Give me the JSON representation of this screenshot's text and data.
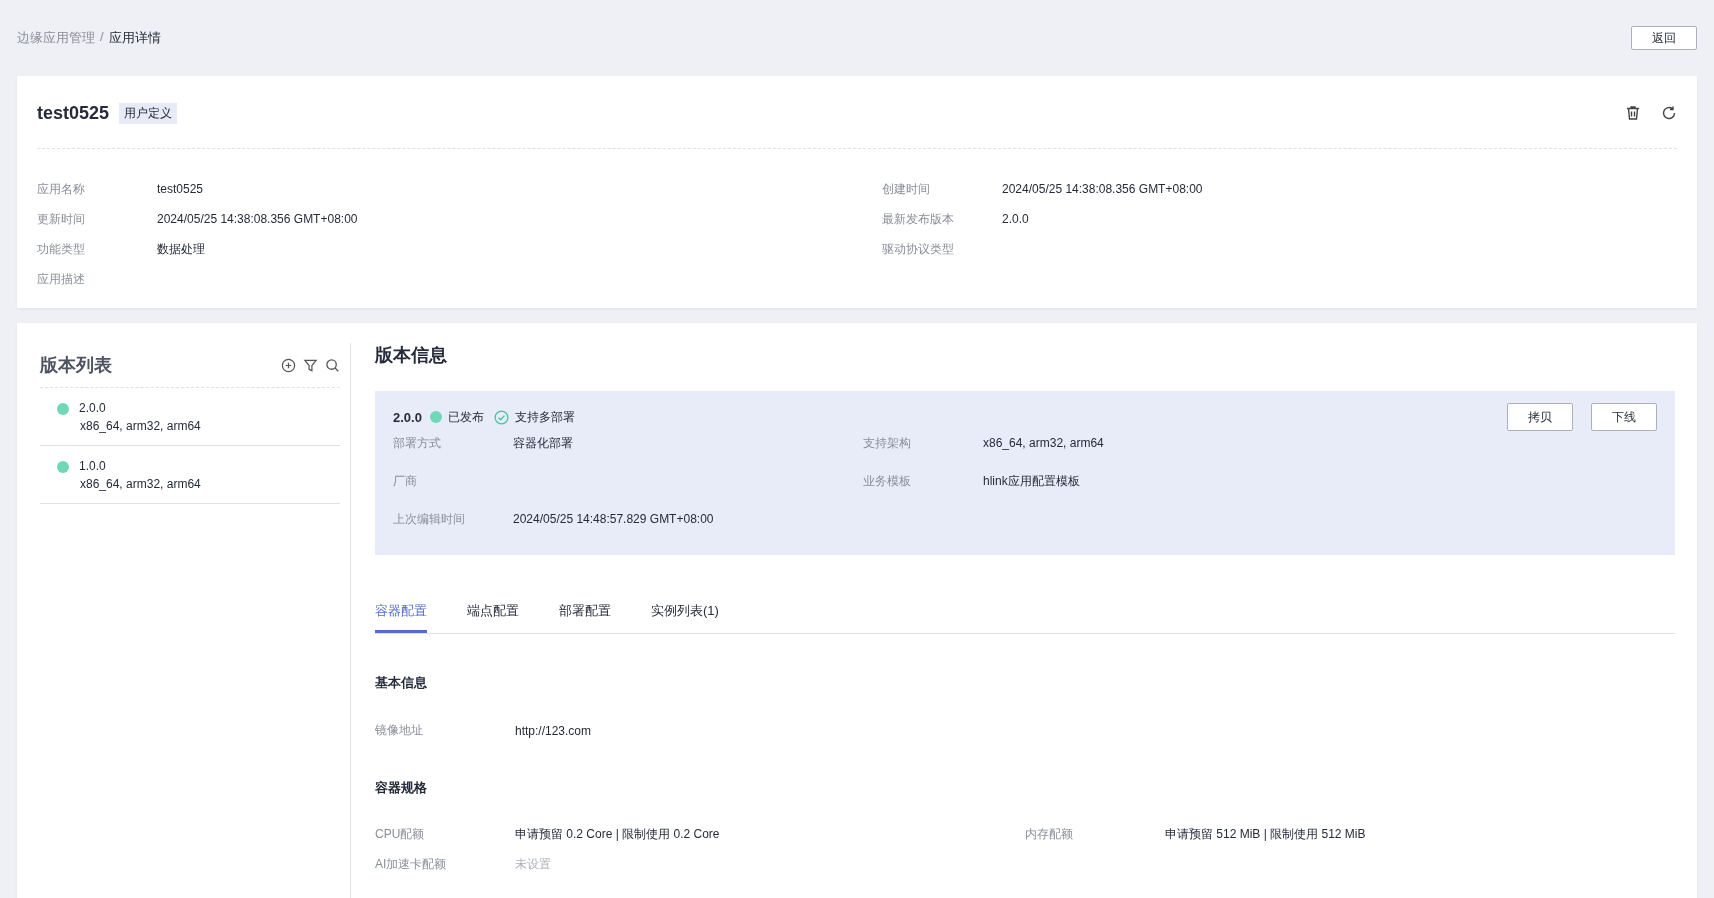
{
  "breadcrumb": {
    "parent": "边缘应用管理",
    "separator": "/",
    "current": "应用详情"
  },
  "back_button": "返回",
  "app": {
    "name": "test0525",
    "tag": "用户定义",
    "fields_left": [
      {
        "label": "应用名称",
        "value": "test0525"
      },
      {
        "label": "更新时间",
        "value": "2024/05/25 14:38:08.356 GMT+08:00"
      },
      {
        "label": "功能类型",
        "value": "数据处理"
      },
      {
        "label": "应用描述"
      }
    ],
    "fields_right": [
      {
        "label": "创建时间",
        "value": "2024/05/25 14:38:08.356 GMT+08:00"
      },
      {
        "label": "最新发布版本",
        "value": "2.0.0"
      },
      {
        "label": "驱动协议类型"
      }
    ]
  },
  "version_list": {
    "title": "版本列表",
    "items": [
      {
        "version": "2.0.0",
        "arch": "x86_64, arm32, arm64"
      },
      {
        "version": "1.0.0",
        "arch": "x86_64, arm32, arm64"
      }
    ]
  },
  "version_info": {
    "title": "版本信息",
    "version": "2.0.0",
    "status": "已发布",
    "multi_deploy": "支持多部署",
    "buttons": [
      "拷贝",
      "下线"
    ],
    "fields_left": [
      {
        "label": "部署方式",
        "value": "容器化部署"
      },
      {
        "label": "厂商"
      },
      {
        "label": "上次编辑时间",
        "value": "2024/05/25 14:48:57.829 GMT+08:00"
      }
    ],
    "fields_right": [
      {
        "label": "支持架构",
        "value": "x86_64, arm32, arm64"
      },
      {
        "label": "业务模板",
        "value": "hlink应用配置模板"
      }
    ]
  },
  "tabs": [
    {
      "label": "容器配置",
      "selected": true
    },
    {
      "label": "端点配置",
      "selected": false
    },
    {
      "label": "部署配置",
      "selected": false
    },
    {
      "label": "实例列表(1)",
      "selected": false
    }
  ],
  "basic_info": {
    "title": "基本信息",
    "fields": [
      {
        "label": "镜像地址",
        "value": "http://123.com"
      }
    ]
  },
  "container_spec": {
    "title": "容器规格",
    "rows": [
      [
        {
          "label": "CPU配额",
          "value": "申请预留 0.2 Core | 限制使用 0.2 Core",
          "muted": false
        },
        {
          "label": "内存配额",
          "value": "申请预留 512 MiB | 限制使用 512 MiB",
          "muted": false
        }
      ],
      [
        {
          "label": "AI加速卡配额",
          "value": "未设置",
          "muted": true
        }
      ]
    ]
  }
}
